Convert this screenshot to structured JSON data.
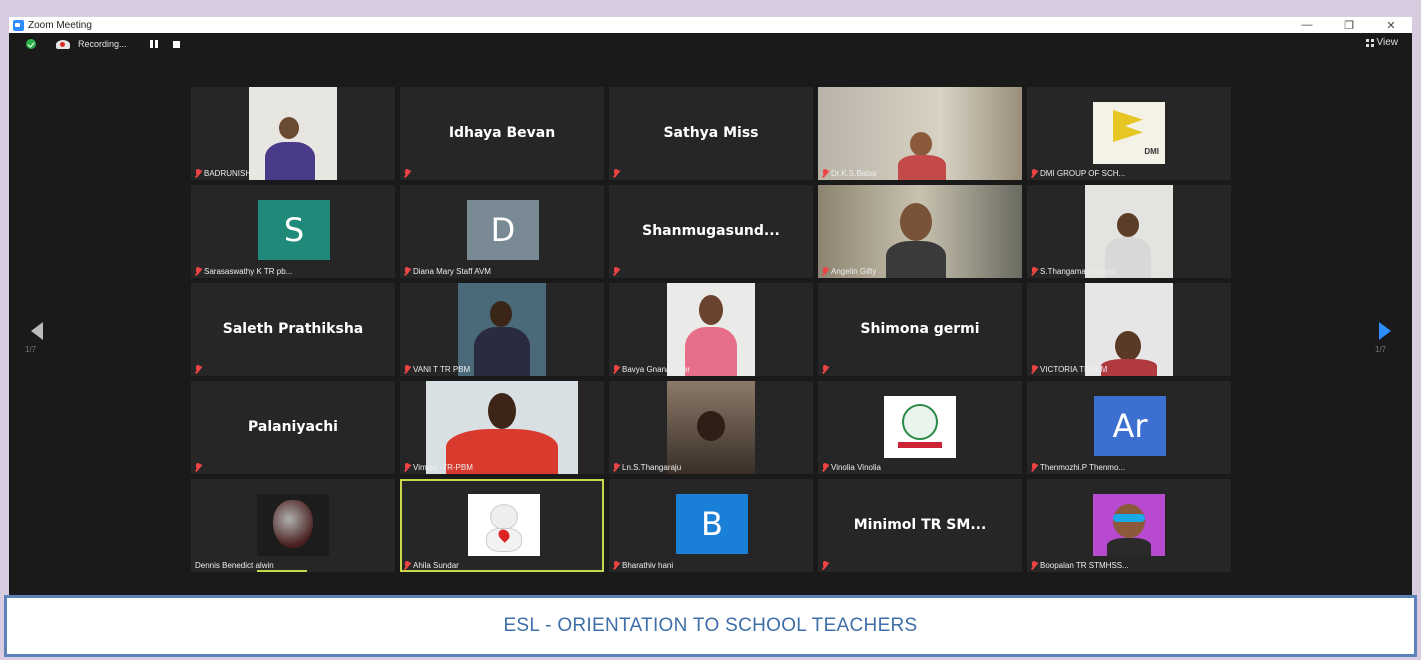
{
  "window": {
    "title": "Zoom Meeting",
    "controls": [
      "—",
      "❐",
      "✕"
    ]
  },
  "toolbar": {
    "recording_label": "Recording...",
    "view_label": "View"
  },
  "nav": {
    "left_page": "1/7",
    "right_page": "1/7"
  },
  "tiles": [
    {
      "label": "BADRUNISHA /",
      "type": "video"
    },
    {
      "label": "",
      "name": "Idhaya Bevan",
      "type": "name"
    },
    {
      "label": "",
      "name": "Sathya Miss",
      "type": "name"
    },
    {
      "label": "Dr.K.S.Babai",
      "type": "video"
    },
    {
      "label": "DMI GROUP OF SCH...",
      "type": "logo"
    },
    {
      "label": "Sarasaswathy K TR pb...",
      "type": "avatar",
      "letter": "S",
      "color": "#1f8a7a"
    },
    {
      "label": "Diana Mary Staff AVM",
      "type": "avatar",
      "letter": "D",
      "color": "#7a8a95"
    },
    {
      "label": "",
      "name": "Shanmugasund...",
      "type": "name"
    },
    {
      "label": "Angelin Gifty",
      "type": "video"
    },
    {
      "label": "S.Thangamani vo.ppt",
      "type": "video"
    },
    {
      "label": "",
      "name": "Saleth Prathiksha",
      "type": "name"
    },
    {
      "label": "VANI T TR PBM",
      "type": "video"
    },
    {
      "label": "Bavya Gnanasekar",
      "type": "video"
    },
    {
      "label": "",
      "name": "Shimona germi",
      "type": "name"
    },
    {
      "label": "VICTORIA TRPBM",
      "type": "video"
    },
    {
      "label": "",
      "name": "Palaniyachi",
      "type": "name"
    },
    {
      "label": "Vimala -TR-PBM",
      "type": "video"
    },
    {
      "label": "Ln.S.Thangaraju",
      "type": "video"
    },
    {
      "label": "Vinolia Vinolia",
      "type": "logo"
    },
    {
      "label": "Thenmozhi.P Thenmo...",
      "type": "avatar",
      "letter": "Ar",
      "color": "#3d6fd1"
    },
    {
      "label": "Dennis Benedict alwin",
      "type": "video"
    },
    {
      "label": "Ahila Sundar",
      "type": "video"
    },
    {
      "label": "Bharathiv hani",
      "type": "avatar",
      "letter": "B",
      "color": "#1a7fd6"
    },
    {
      "label": "",
      "name": "Minimol TR SM...",
      "type": "name"
    },
    {
      "label": "Boopalan TR STMHSS...",
      "type": "video"
    }
  ],
  "logo_text": "DMI",
  "caption": "ESL - ORIENTATION TO SCHOOL TEACHERS"
}
